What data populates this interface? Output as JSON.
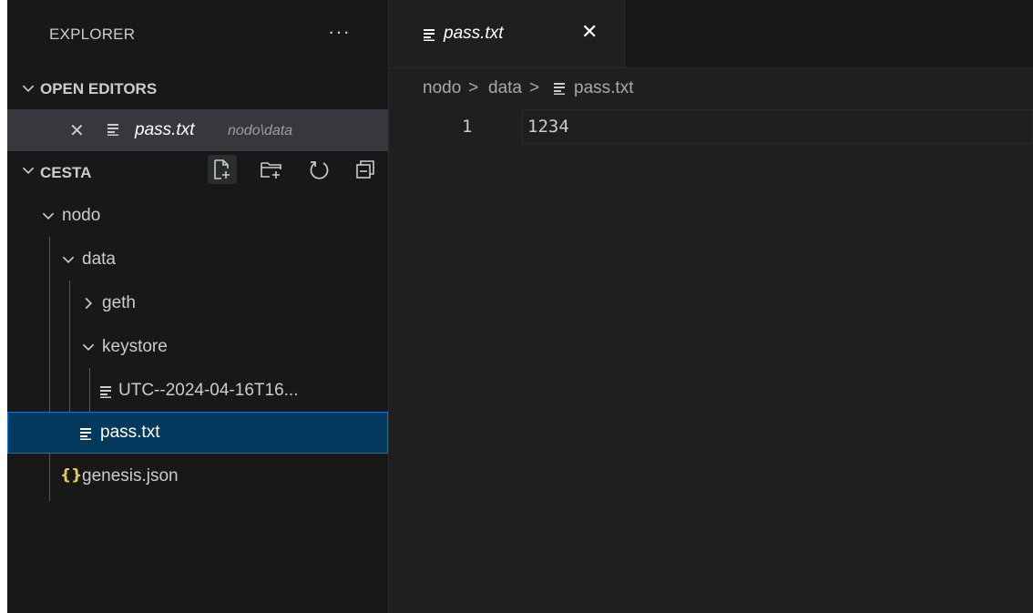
{
  "explorer": {
    "title": "EXPLORER",
    "more_label": "···",
    "open_editors": {
      "header": "OPEN EDITORS",
      "items": [
        {
          "name": "pass.txt",
          "path": "nodo\\data",
          "close": "✕"
        }
      ]
    },
    "workspace": {
      "header": "CESTA",
      "actions": [
        "new-file-icon",
        "new-folder-icon",
        "refresh-icon",
        "collapse-all-icon"
      ],
      "tree": {
        "nodo": "nodo",
        "data": "data",
        "geth": "geth",
        "keystore": "keystore",
        "utc_file": "UTC--2024-04-16T16...",
        "pass_file": "pass.txt",
        "genesis": "genesis.json"
      }
    }
  },
  "editor": {
    "tab": {
      "name": "pass.txt",
      "close": "✕"
    },
    "breadcrumb": {
      "part1": "nodo",
      "sep": ">",
      "part2": "data",
      "part3": "pass.txt"
    },
    "lines": [
      {
        "number": "1",
        "text": "1234"
      }
    ]
  },
  "colors": {
    "sidebar_bg": "#181818",
    "editor_bg": "#1f1f1f",
    "selection_bg": "#04395e",
    "selection_border": "#0078d4",
    "json_icon": "#e6cd49"
  }
}
